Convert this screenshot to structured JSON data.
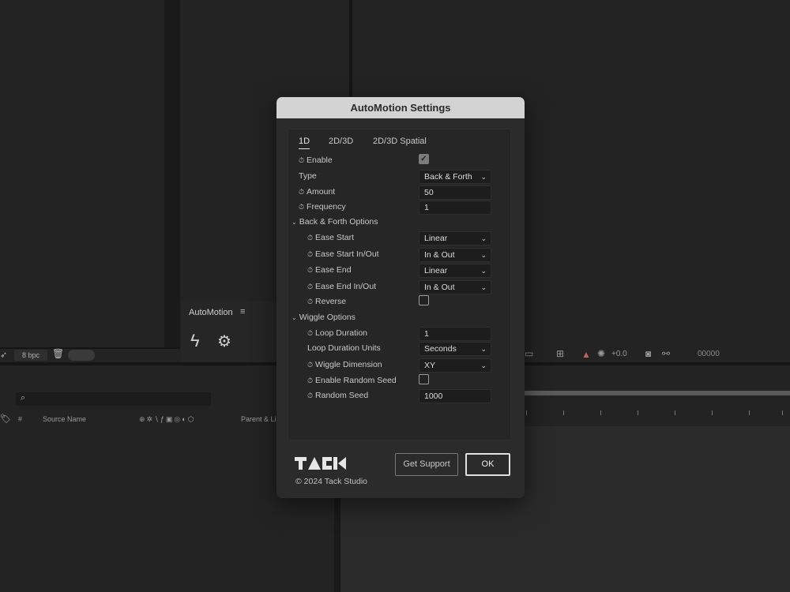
{
  "background": {
    "bpc_label": "8 bpc",
    "panel_title": "AutoMotion",
    "panel_menu": "≡",
    "source_name_header": "Source Name",
    "hash_header": "#",
    "parent_link_header": "Parent & Lin",
    "zoom_value": "+0.0",
    "timecode": "00000"
  },
  "dialog": {
    "title": "AutoMotion Settings",
    "tabs": [
      "1D",
      "2D/3D",
      "2D/3D Spatial"
    ],
    "rows": {
      "enable": {
        "label": "Enable",
        "checked": true
      },
      "type": {
        "label": "Type",
        "value": "Back & Forth"
      },
      "amount": {
        "label": "Amount",
        "value": "50"
      },
      "frequency": {
        "label": "Frequency",
        "value": "1"
      },
      "back_forth_section": "Back & Forth Options",
      "ease_start": {
        "label": "Ease Start",
        "value": "Linear"
      },
      "ease_start_inout": {
        "label": "Ease Start In/Out",
        "value": "In & Out"
      },
      "ease_end": {
        "label": "Ease End",
        "value": "Linear"
      },
      "ease_end_inout": {
        "label": "Ease End In/Out",
        "value": "In & Out"
      },
      "reverse": {
        "label": "Reverse",
        "checked": false
      },
      "wiggle_section": "Wiggle Options",
      "loop_duration": {
        "label": "Loop Duration",
        "value": "1"
      },
      "loop_duration_units": {
        "label": "Loop Duration Units",
        "value": "Seconds"
      },
      "wiggle_dimension": {
        "label": "Wiggle Dimension",
        "value": "XY"
      },
      "enable_random_seed": {
        "label": "Enable Random Seed",
        "checked": false
      },
      "random_seed": {
        "label": "Random Seed",
        "value": "1000"
      }
    },
    "copyright": "© 2024 Tack Studio",
    "get_support_label": "Get Support",
    "ok_label": "OK"
  }
}
